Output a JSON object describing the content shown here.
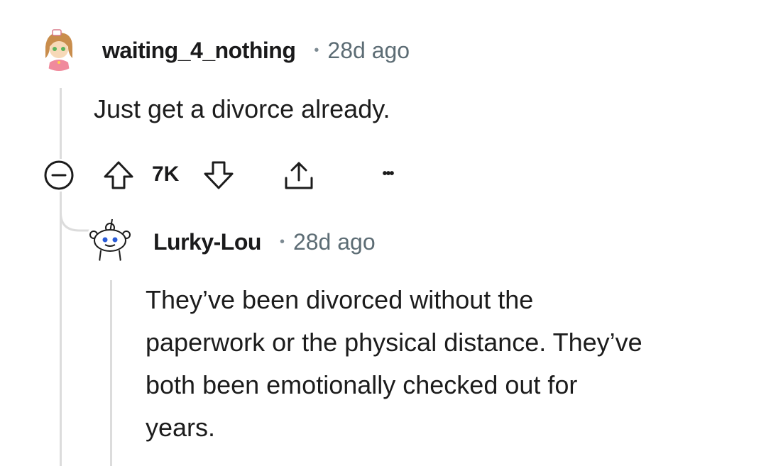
{
  "comments": [
    {
      "username": "waiting_4_nothing",
      "time": "28d ago",
      "separator": "•",
      "body": "Just get a divorce already.",
      "score": "7K",
      "more": "•••"
    },
    {
      "username": "Lurky-Lou",
      "time": "28d ago",
      "separator": "•",
      "body_lines": [
        "They’ve been divorced without the",
        "paperwork or the physical distance. They’ve",
        "both been emotionally checked out for",
        "years."
      ]
    }
  ]
}
